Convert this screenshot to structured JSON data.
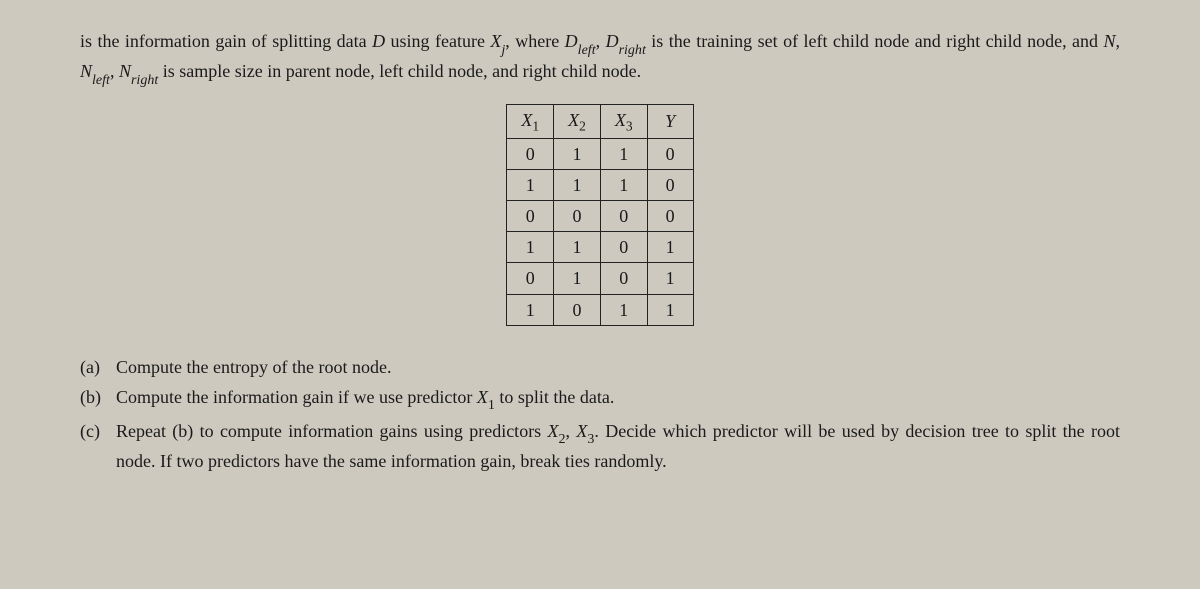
{
  "intro": {
    "line1_prefix": "is the information gain of splitting data ",
    "D": "D",
    "line1_mid1": " using feature ",
    "Xj": "X",
    "j_sub": "j",
    "line1_mid2": ", where ",
    "Dleft": "D",
    "left_sub": "left",
    "comma1": ", ",
    "Dright": "D",
    "right_sub": "right",
    "line1_mid3": " is the training set of left child node and right child node, and ",
    "N": "N",
    "comma2": ", ",
    "Nleft": "N",
    "comma3": ", ",
    "Nright": "N",
    "line1_end": " is sample size in parent node, left child node, and right child node."
  },
  "table": {
    "headers": {
      "h1": "X",
      "h1sub": "1",
      "h2": "X",
      "h2sub": "2",
      "h3": "X",
      "h3sub": "3",
      "h4": "Y"
    },
    "rows": [
      {
        "c1": "0",
        "c2": "1",
        "c3": "1",
        "c4": "0"
      },
      {
        "c1": "1",
        "c2": "1",
        "c3": "1",
        "c4": "0"
      },
      {
        "c1": "0",
        "c2": "0",
        "c3": "0",
        "c4": "0"
      },
      {
        "c1": "1",
        "c2": "1",
        "c3": "0",
        "c4": "1"
      },
      {
        "c1": "0",
        "c2": "1",
        "c3": "0",
        "c4": "1"
      },
      {
        "c1": "1",
        "c2": "0",
        "c3": "1",
        "c4": "1"
      }
    ]
  },
  "questions": {
    "a": {
      "label": "(a)",
      "text": "Compute the entropy of the root node."
    },
    "b": {
      "label": "(b)",
      "pre": "Compute the information gain if we use predictor ",
      "X1": "X",
      "X1sub": "1",
      "post": " to split the data."
    },
    "c": {
      "label": "(c)",
      "pre": "Repeat (b) to compute information gains using predictors ",
      "X2": "X",
      "X2sub": "2",
      "comma": ", ",
      "X3": "X",
      "X3sub": "3",
      "post": ". Decide which predictor will be used by decision tree to split the root node. If two predictors have the same information gain, break ties randomly."
    }
  }
}
